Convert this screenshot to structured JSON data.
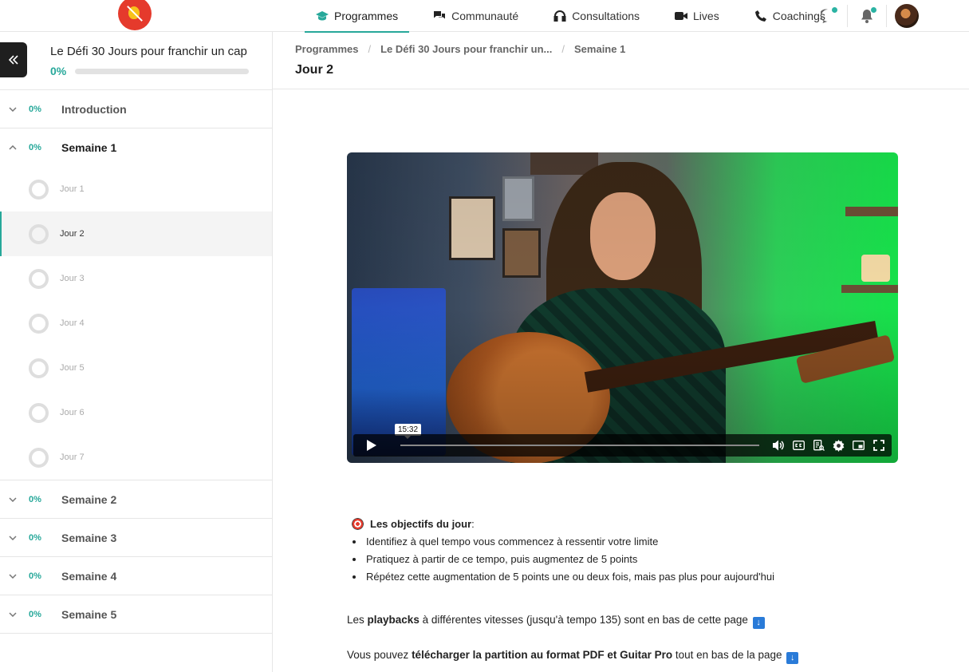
{
  "nav": {
    "items": [
      {
        "label": "Programmes",
        "icon": "graduation-cap-icon",
        "active": true
      },
      {
        "label": "Communauté",
        "icon": "chat-bubbles-icon",
        "active": false
      },
      {
        "label": "Consultations",
        "icon": "headset-icon",
        "active": false
      },
      {
        "label": "Lives",
        "icon": "video-camera-icon",
        "active": false
      },
      {
        "label": "Coachings",
        "icon": "phone-icon",
        "active": false
      }
    ],
    "accent": "#27a89a"
  },
  "sidebar": {
    "course_title": "Le Défi 30 Jours pour franchir un cap",
    "progress_label": "0%",
    "progress": 0,
    "sections": [
      {
        "pct": "0%",
        "name": "Introduction",
        "open": false
      },
      {
        "pct": "0%",
        "name": "Semaine 1",
        "open": true,
        "lessons": [
          {
            "name": "Jour 1"
          },
          {
            "name": "Jour 2",
            "active": true
          },
          {
            "name": "Jour 3"
          },
          {
            "name": "Jour 4"
          },
          {
            "name": "Jour 5"
          },
          {
            "name": "Jour 6"
          },
          {
            "name": "Jour 7"
          }
        ]
      },
      {
        "pct": "0%",
        "name": "Semaine 2",
        "open": false
      },
      {
        "pct": "0%",
        "name": "Semaine 3",
        "open": false
      },
      {
        "pct": "0%",
        "name": "Semaine 4",
        "open": false
      },
      {
        "pct": "0%",
        "name": "Semaine 5",
        "open": false
      }
    ]
  },
  "breadcrumb": [
    "Programmes",
    "Le Défi 30 Jours pour franchir un...",
    "Semaine 1"
  ],
  "page_title": "Jour 2",
  "video": {
    "timecode": "15:32",
    "progress": 0
  },
  "content": {
    "objectives_title": "Les objectifs du jour",
    "objectives_suffix": " :",
    "objectives": [
      "Identifiez à quel tempo vous commencez à ressentir votre limite",
      "Pratiquez à partir de ce tempo, puis augmentez de 5 points",
      "Répétez cette augmentation de 5 points une ou deux fois, mais pas plus pour aujourd'hui"
    ],
    "p1": {
      "pre": "Les ",
      "bold": "playbacks",
      "post": " à différentes vitesses (jusqu'à tempo 135) sont en bas de cette page "
    },
    "p2": {
      "pre": "Vous pouvez ",
      "bold": "télécharger la partition au format PDF et Guitar Pro",
      "post": " tout en bas de la page "
    },
    "arrow_glyph": "↓"
  }
}
